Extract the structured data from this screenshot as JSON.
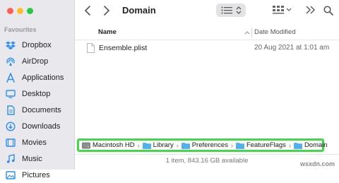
{
  "sidebar": {
    "heading": "Favourites",
    "items": [
      {
        "label": "Dropbox",
        "icon": "dropbox-icon"
      },
      {
        "label": "AirDrop",
        "icon": "airdrop-icon"
      },
      {
        "label": "Applications",
        "icon": "applications-icon"
      },
      {
        "label": "Desktop",
        "icon": "desktop-icon"
      },
      {
        "label": "Documents",
        "icon": "documents-icon"
      },
      {
        "label": "Downloads",
        "icon": "downloads-icon"
      },
      {
        "label": "Movies",
        "icon": "movies-icon"
      },
      {
        "label": "Music",
        "icon": "music-icon"
      },
      {
        "label": "Pictures",
        "icon": "pictures-icon"
      }
    ]
  },
  "toolbar": {
    "title": "Domain"
  },
  "columns": {
    "name": "Name",
    "date_modified": "Date Modified"
  },
  "files": [
    {
      "name": "Ensemble.plist",
      "date": "20 Aug 2021 at 1:01 am"
    }
  ],
  "pathbar": {
    "crumbs": [
      "Macintosh HD",
      "Library",
      "Preferences",
      "FeatureFlags",
      "Domain"
    ],
    "highlight_color": "#42d84a"
  },
  "status": "1 item, 843.16 GB available",
  "watermark": "wsxdn.com",
  "colors": {
    "accent": "#2d8ff0",
    "folder": "#4fb0ee"
  }
}
